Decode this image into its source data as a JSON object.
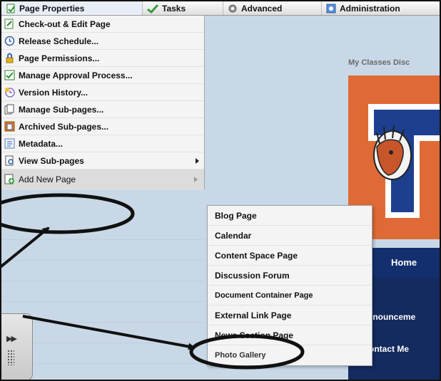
{
  "menubar": {
    "items": [
      {
        "label": "Page Properties",
        "icon": "page-properties-icon"
      },
      {
        "label": "Tasks",
        "icon": "checkmark-icon"
      },
      {
        "label": "Advanced",
        "icon": "gear-icon"
      },
      {
        "label": "Administration",
        "icon": "admin-icon"
      }
    ]
  },
  "page_menu": {
    "items": [
      {
        "label": "Check-out & Edit Page"
      },
      {
        "label": "Release Schedule..."
      },
      {
        "label": "Page Permissions..."
      },
      {
        "label": "Manage Approval Process..."
      },
      {
        "label": "Version History..."
      },
      {
        "label": "Manage Sub-pages..."
      },
      {
        "label": "Archived Sub-pages..."
      },
      {
        "label": "Metadata..."
      },
      {
        "label": "View Sub-pages"
      },
      {
        "label": "Add New Page"
      }
    ]
  },
  "submenu": {
    "items": [
      {
        "label": "Blog Page"
      },
      {
        "label": "Calendar"
      },
      {
        "label": "Content Space Page"
      },
      {
        "label": "Discussion Forum"
      },
      {
        "label": "Document Container Page"
      },
      {
        "label": "External Link Page"
      },
      {
        "label": "News Section Page"
      },
      {
        "label": "Photo Gallery"
      }
    ]
  },
  "site": {
    "tabs_text": "My Classes   Disc",
    "nav_home": "Home",
    "side_nav": [
      "nnounceme",
      "ontact Me"
    ]
  },
  "colors": {
    "banner": "#e06a35",
    "navy": "#132f6e",
    "background": "#c9d8e6"
  }
}
